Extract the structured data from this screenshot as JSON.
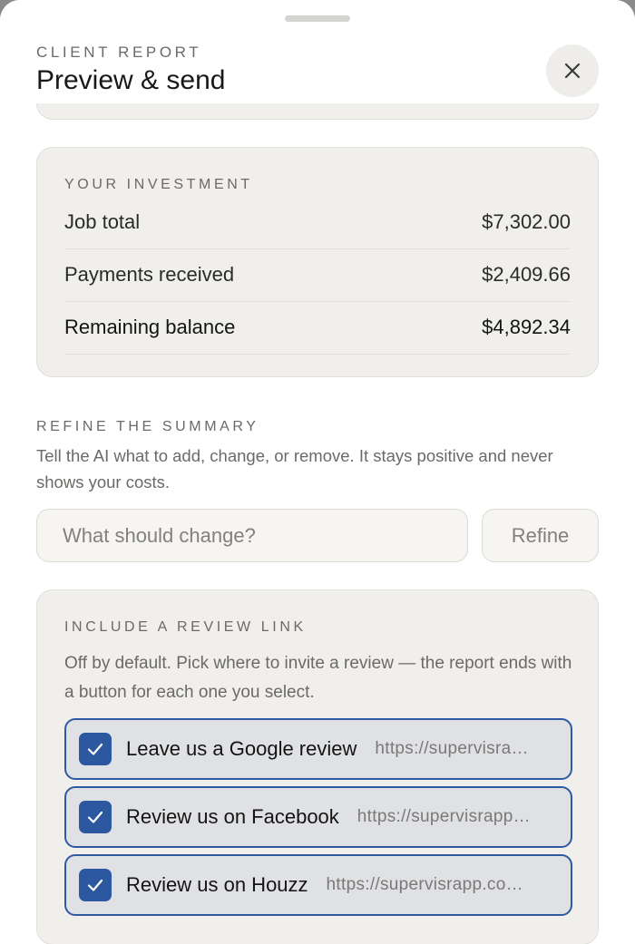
{
  "header": {
    "eyebrow": "CLIENT REPORT",
    "title": "Preview & send"
  },
  "investment": {
    "eyebrow": "YOUR INVESTMENT",
    "rows": [
      {
        "label": "Job total",
        "value": "$7,302.00"
      },
      {
        "label": "Payments received",
        "value": "$2,409.66"
      },
      {
        "label": "Remaining balance",
        "value": "$4,892.34"
      }
    ]
  },
  "refine": {
    "eyebrow": "REFINE THE SUMMARY",
    "helper": "Tell the AI what to add, change, or remove. It stays positive and never shows your costs.",
    "input_value": "",
    "input_placeholder": "What should change?",
    "button_label": "Refine"
  },
  "review": {
    "eyebrow": "INCLUDE A REVIEW LINK",
    "helper": "Off by default. Pick where to invite a review — the report ends with a button for each one you select.",
    "items": [
      {
        "label": "Leave us a Google review",
        "url": "https://supervisra…",
        "checked": true
      },
      {
        "label": "Review us on Facebook",
        "url": "https://supervisrapp…",
        "checked": true
      },
      {
        "label": "Review us on Houzz",
        "url": "https://supervisrapp.co…",
        "checked": true
      }
    ]
  },
  "colors": {
    "accent": "#2c58a0",
    "card_bg": "#f0efeb"
  },
  "icons": {
    "close": "close-icon",
    "check": "checkmark-icon"
  }
}
